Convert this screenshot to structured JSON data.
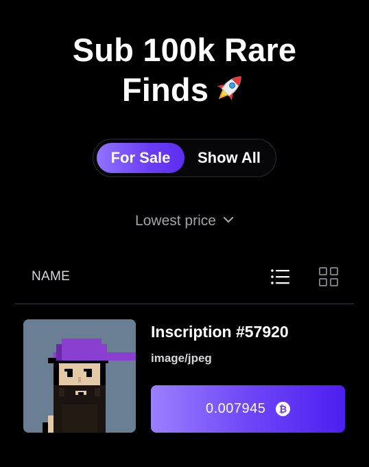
{
  "header": {
    "title_line1": "Sub 100k Rare",
    "title_line2": "Finds"
  },
  "toggle": {
    "active_label": "For Sale",
    "inactive_label": "Show All"
  },
  "sort": {
    "label": "Lowest price"
  },
  "list_header": {
    "name_label": "NAME"
  },
  "item": {
    "title": "Inscription #57920",
    "content_type": "image/jpeg",
    "price": "0.007945"
  },
  "colors": {
    "accent": "#6a3df5",
    "accent_light": "#9173ff",
    "background": "#000000",
    "image_bg": "#6b7f94"
  },
  "icons": [
    "rocket-icon",
    "chevron-down-icon",
    "list-view-icon",
    "grid-view-icon",
    "bitcoin-icon"
  ]
}
